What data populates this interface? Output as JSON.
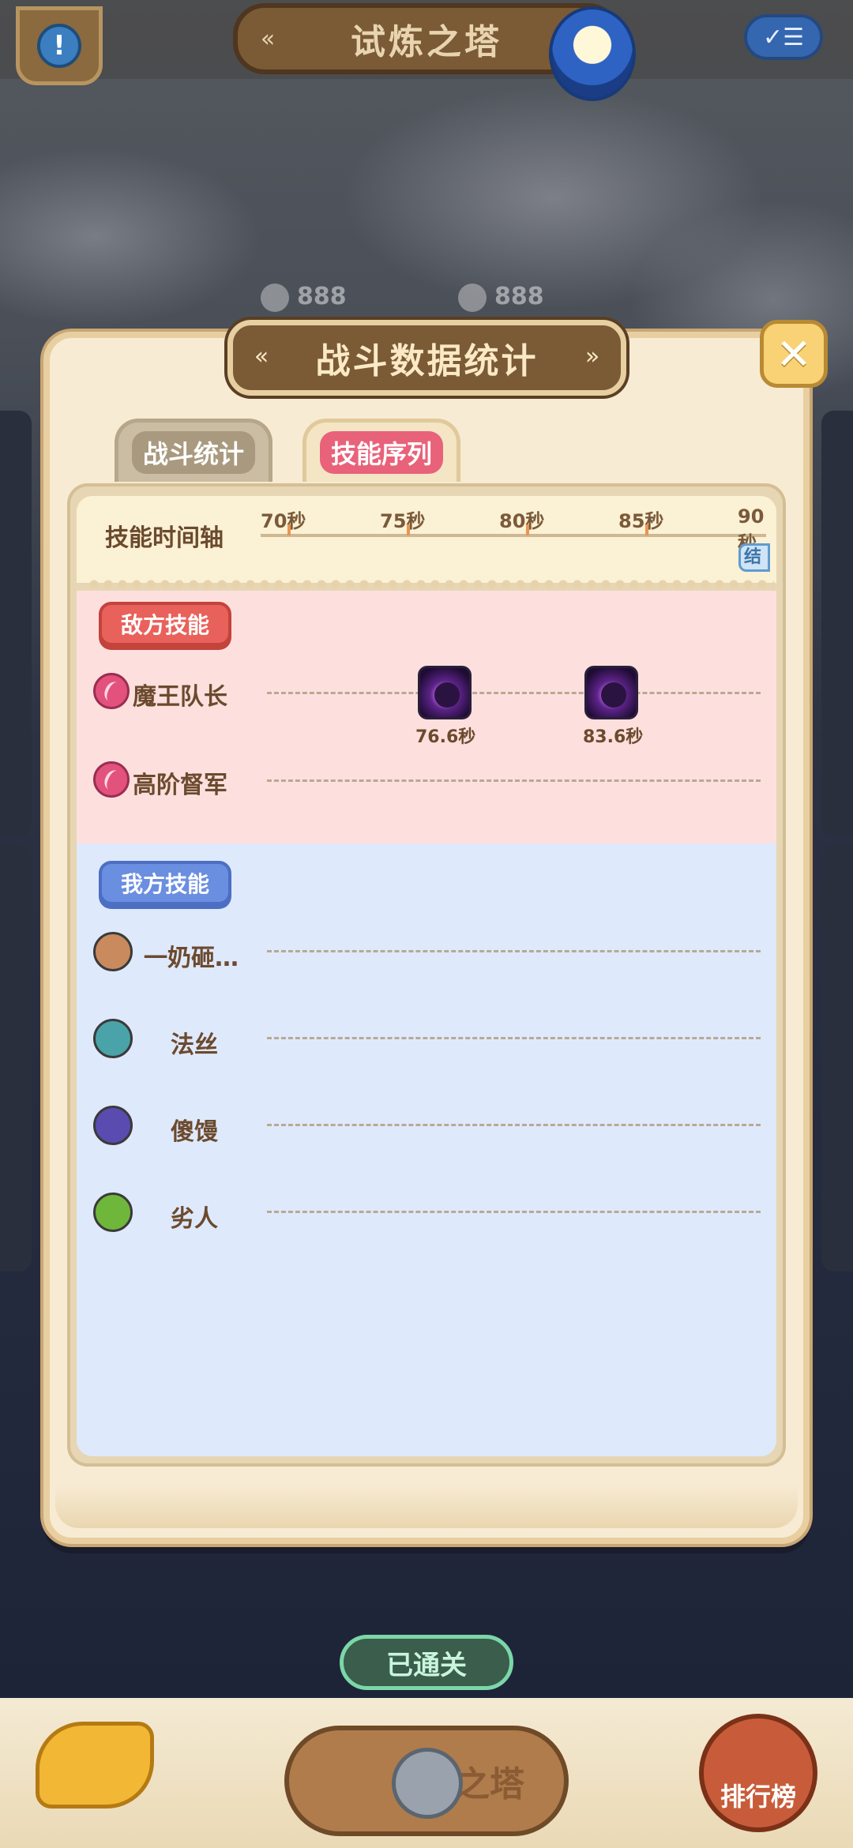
{
  "header": {
    "title": "试炼之塔",
    "menu_icon": "list-check-icon",
    "info_icon": "exclamation-icon"
  },
  "background": {
    "scores": [
      "888",
      "888"
    ]
  },
  "dialog": {
    "title": "战斗数据统计",
    "close_icon": "close-x-icon",
    "tabs": [
      {
        "label": "战斗统计",
        "active": false
      },
      {
        "label": "技能序列",
        "active": true
      }
    ],
    "timeline": {
      "label": "技能时间轴",
      "ticks": [
        "70秒",
        "75秒",
        "80秒",
        "85秒",
        "90秒"
      ],
      "end_chip": "结束"
    },
    "enemy": {
      "badge": "敌方技能",
      "rows": [
        {
          "name": "魔王队长",
          "skills": [
            {
              "time": "76.6秒",
              "icon": "shadow-demon-skill-icon"
            },
            {
              "time": "83.6秒",
              "icon": "dark-summon-skill-icon"
            }
          ]
        },
        {
          "name": "高阶督军",
          "skills": []
        }
      ]
    },
    "ally": {
      "badge": "我方技能",
      "rows": [
        {
          "name": "一奶砸…",
          "icon": "tiger-icon",
          "color": "#c98a5d"
        },
        {
          "name": "法丝",
          "icon": "leaf-swirl-icon",
          "color": "#4aa3a8"
        },
        {
          "name": "傻馒",
          "icon": "totem-icon",
          "color": "#5a4bb0"
        },
        {
          "name": "劣人",
          "icon": "vine-icon",
          "color": "#6fb73a"
        }
      ]
    }
  },
  "bottom": {
    "cleared_label": "已通关",
    "center_label": "之塔",
    "rank_label": "排行榜"
  }
}
